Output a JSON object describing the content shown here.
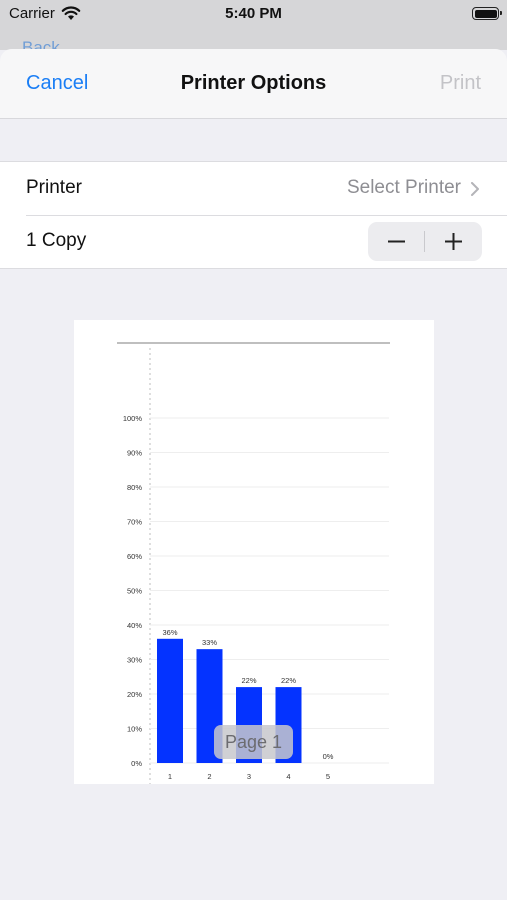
{
  "status_bar": {
    "carrier": "Carrier",
    "time": "5:40 PM"
  },
  "backdrop": {
    "back_label": "Back"
  },
  "nav": {
    "cancel_label": "Cancel",
    "title": "Printer Options",
    "print_label": "Print"
  },
  "settings": {
    "printer_label": "Printer",
    "printer_value": "Select Printer",
    "copies_label": "1 Copy"
  },
  "preview": {
    "page_label": "Page 1"
  },
  "chart_data": {
    "type": "bar",
    "categories": [
      "1",
      "2",
      "3",
      "4",
      "5"
    ],
    "values": [
      36,
      33,
      22,
      22,
      0
    ],
    "data_labels": [
      "36%",
      "33%",
      "22%",
      "22%",
      "0%"
    ],
    "y_ticks": [
      "0%",
      "10%",
      "20%",
      "30%",
      "40%",
      "50%",
      "60%",
      "70%",
      "80%",
      "90%",
      "100%"
    ],
    "ylim": [
      0,
      100
    ],
    "bar_color": "#0433ff",
    "grid": true
  }
}
